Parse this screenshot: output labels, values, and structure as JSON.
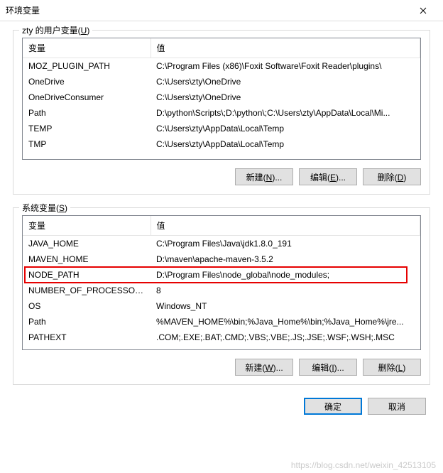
{
  "window": {
    "title": "环境变量"
  },
  "userSection": {
    "label_pre": "zty 的用户变量(",
    "label_u": "U",
    "label_post": ")",
    "headers": {
      "var": "变量",
      "val": "值"
    },
    "rows": [
      {
        "var": "MOZ_PLUGIN_PATH",
        "val": "C:\\Program Files (x86)\\Foxit Software\\Foxit Reader\\plugins\\"
      },
      {
        "var": "OneDrive",
        "val": "C:\\Users\\zty\\OneDrive"
      },
      {
        "var": "OneDriveConsumer",
        "val": "C:\\Users\\zty\\OneDrive"
      },
      {
        "var": "Path",
        "val": "D:\\python\\Scripts\\;D:\\python\\;C:\\Users\\zty\\AppData\\Local\\Mi..."
      },
      {
        "var": "TEMP",
        "val": "C:\\Users\\zty\\AppData\\Local\\Temp"
      },
      {
        "var": "TMP",
        "val": "C:\\Users\\zty\\AppData\\Local\\Temp"
      }
    ],
    "buttons": {
      "new": "新建(N)...",
      "edit": "编辑(E)...",
      "delete": "删除(D)"
    }
  },
  "systemSection": {
    "label_pre": "系统变量(",
    "label_u": "S",
    "label_post": ")",
    "headers": {
      "var": "变量",
      "val": "值"
    },
    "rows": [
      {
        "var": "JAVA_HOME",
        "val": "C:\\Program Files\\Java\\jdk1.8.0_191"
      },
      {
        "var": "MAVEN_HOME",
        "val": "D:\\maven\\apache-maven-3.5.2"
      },
      {
        "var": "NODE_PATH",
        "val": "D:\\Program Files\\node_global\\node_modules;",
        "highlight": true
      },
      {
        "var": "NUMBER_OF_PROCESSORS",
        "val": "8"
      },
      {
        "var": "OS",
        "val": "Windows_NT"
      },
      {
        "var": "Path",
        "val": "%MAVEN_HOME%\\bin;%Java_Home%\\bin;%Java_Home%\\jre..."
      },
      {
        "var": "PATHEXT",
        "val": ".COM;.EXE;.BAT;.CMD;.VBS;.VBE;.JS;.JSE;.WSF;.WSH;.MSC"
      }
    ],
    "buttons": {
      "new": "新建(W)...",
      "edit": "编辑(I)...",
      "delete": "删除(L)"
    }
  },
  "footer": {
    "ok": "确定",
    "cancel": "取消"
  },
  "watermark": "https://blog.csdn.net/weixin_42513105"
}
